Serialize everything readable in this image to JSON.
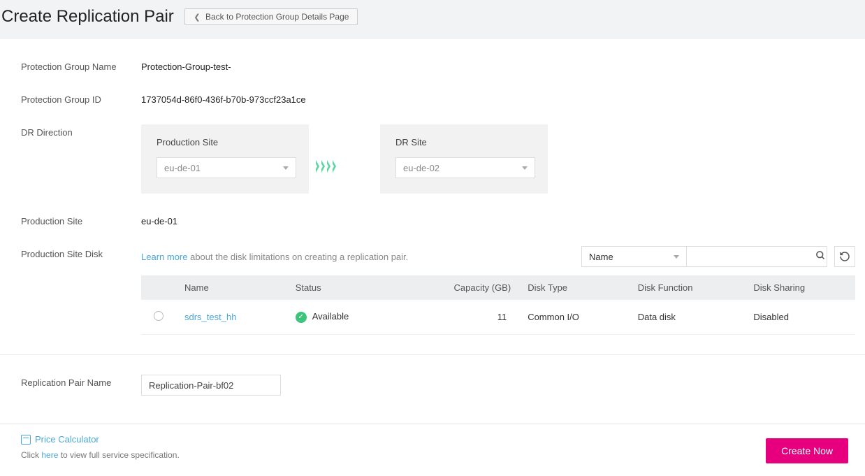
{
  "header": {
    "title": "Create Replication Pair",
    "back_label": "Back to Protection Group Details Page"
  },
  "labels": {
    "protection_group_name": "Protection Group Name",
    "protection_group_id": "Protection Group ID",
    "dr_direction": "DR Direction",
    "production_site": "Production Site",
    "dr_site": "DR Site",
    "production_site_disk": "Production Site Disk",
    "replication_pair_name": "Replication Pair Name"
  },
  "values": {
    "protection_group_name": "Protection-Group-test-",
    "protection_group_id": "1737054d-86f0-436f-b70b-973ccf23a1ce",
    "production_site_code": "eu-de-01",
    "dr_site_code": "eu-de-02",
    "replication_pair_name": "Replication-Pair-bf02"
  },
  "disk_table": {
    "learn_more": "Learn more",
    "learn_rest": " about the disk limitations on creating a replication pair.",
    "search_by": "Name",
    "columns": {
      "name": "Name",
      "status": "Status",
      "capacity": "Capacity (GB)",
      "disk_type": "Disk Type",
      "disk_function": "Disk Function",
      "disk_sharing": "Disk Sharing"
    },
    "rows": [
      {
        "name": "sdrs_test_hh",
        "status": "Available",
        "capacity": "11",
        "disk_type": "Common I/O",
        "disk_function": "Data disk",
        "disk_sharing": "Disabled"
      }
    ]
  },
  "footer": {
    "price_calculator": "Price Calculator",
    "spec_prefix": "Click ",
    "spec_link": "here",
    "spec_suffix": " to view full service specification.",
    "create_now": "Create Now"
  }
}
